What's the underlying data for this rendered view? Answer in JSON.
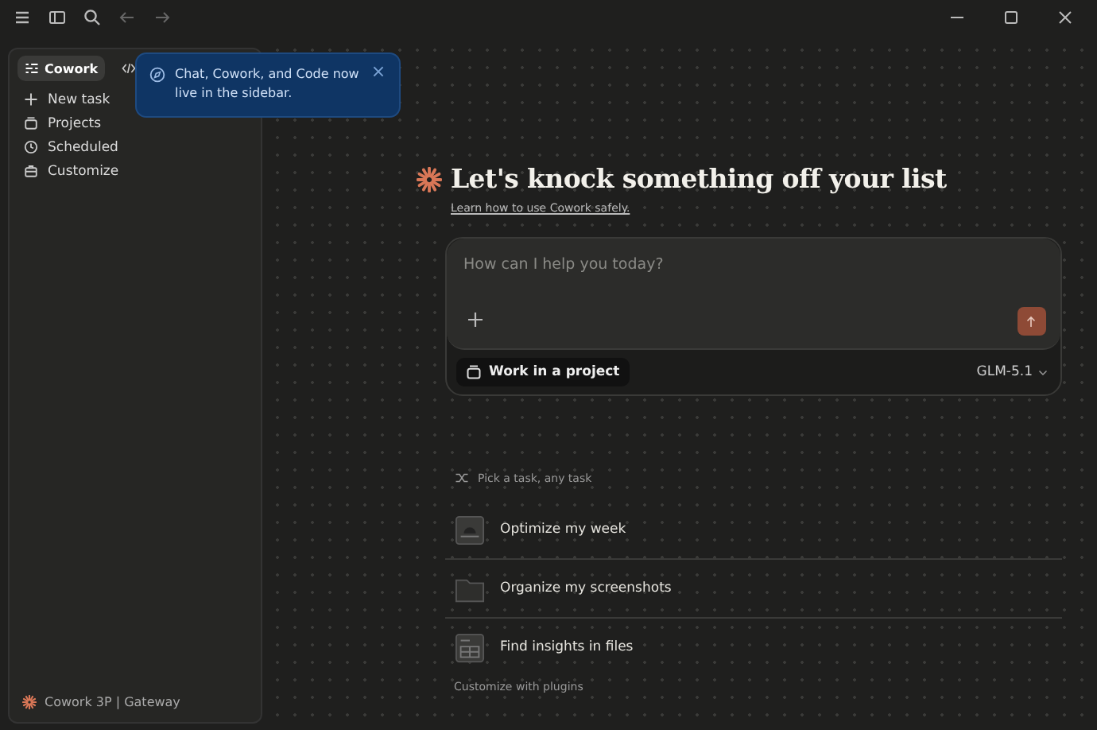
{
  "sidebar": {
    "modes": [
      {
        "kind": "cowork",
        "label": "Cowork",
        "selected": true
      },
      {
        "kind": "code",
        "selected": false
      }
    ],
    "items": [
      {
        "kind": "new",
        "label": "New task"
      },
      {
        "kind": "projects",
        "label": "Projects"
      },
      {
        "kind": "scheduled",
        "label": "Scheduled"
      },
      {
        "kind": "customize",
        "label": "Customize"
      }
    ],
    "footer": "Cowork 3P | Gateway"
  },
  "tooltip": {
    "text": "Chat, Cowork, and Code now live in the sidebar."
  },
  "hero": {
    "title": "Let's knock something off your list",
    "link": "Learn how to use Cowork safely."
  },
  "composer": {
    "placeholder": "How can I help you today?",
    "project_button": "Work in a project",
    "model": "GLM-5.1"
  },
  "tasks": {
    "label": "Pick a task, any task",
    "items": [
      {
        "kind": "calendar",
        "label": "Optimize my week"
      },
      {
        "kind": "folder",
        "label": "Organize my screenshots"
      },
      {
        "kind": "table",
        "label": "Find insights in files"
      }
    ],
    "footer": "Customize with plugins"
  }
}
